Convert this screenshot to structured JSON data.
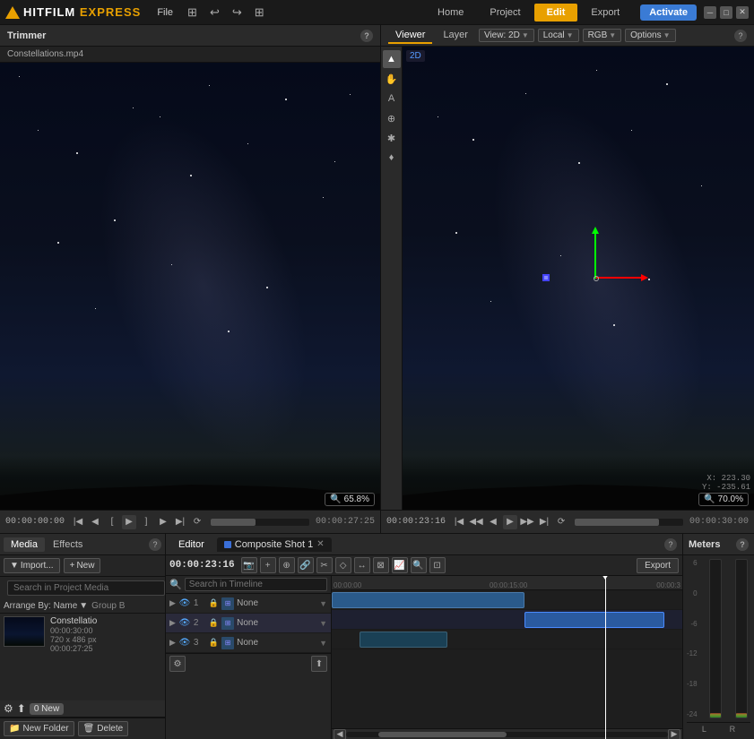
{
  "app": {
    "name": "HITFILM",
    "name_accent": "EXPRESS",
    "logo_text": "HitFilm Express"
  },
  "menubar": {
    "file": "File",
    "edit_menu": "Edit",
    "project": "Project",
    "icons": [
      "⧉",
      "↩",
      "↪",
      "⊞"
    ],
    "nav": {
      "home": "Home",
      "project_tab": "Project",
      "edit_tab": "Edit",
      "export_tab": "Export",
      "activate": "Activate"
    },
    "win_controls": [
      "─",
      "□",
      "✕"
    ]
  },
  "trimmer": {
    "title": "Trimmer",
    "filename": "Constellations.mp4",
    "zoom_label": "65.8%",
    "time_start": "00:00:00:00",
    "time_end": "00:00:27:25",
    "help": "?"
  },
  "viewer": {
    "title": "Viewer",
    "tabs": [
      "Viewer",
      "Layer"
    ],
    "view_label": "View: 2D",
    "local_label": "Local",
    "rgb_label": "RGB",
    "options_label": "Options",
    "badge_2d": "2D",
    "coords_x": "X: 223.30",
    "coords_y": "Y: -235.61",
    "zoom_label": "70.0%",
    "time": "00:00:23:16",
    "time_end": "00:00:30:00"
  },
  "tools": {
    "items": [
      "▲",
      "✋",
      "A",
      "⊕",
      "✱",
      "♦"
    ]
  },
  "media_panel": {
    "title": "Media",
    "tabs": [
      "Media",
      "Effects"
    ],
    "import_label": "Import...",
    "new_label": "New",
    "search_placeholder": "Search in Project Media",
    "arrange_label": "Arrange By: Name",
    "group_label": "Group B",
    "media_item": {
      "name": "Constellatio",
      "full_name": "Constellations.mp4",
      "duration": "00:00:30:00",
      "resolution": "720 x 486 px",
      "timecode": "00:00:27:25"
    },
    "new_folder": "New Folder",
    "delete": "Delete",
    "new_notification": "0 New"
  },
  "editor": {
    "title": "Editor",
    "comp_shot_label": "Composite Shot 1",
    "time": "00:00:23:16",
    "export_label": "Export",
    "search_placeholder": "Search in Timeline",
    "tracks": [
      {
        "num": "1",
        "name": "None"
      },
      {
        "num": "2",
        "name": "None"
      },
      {
        "num": "3",
        "name": "None"
      }
    ],
    "ruler_marks": [
      "00:00:00",
      "00:00:15:00",
      "00:00:3"
    ]
  },
  "meters": {
    "title": "Meters",
    "db_labels": [
      "6",
      "0",
      "-6",
      "-12",
      "-18",
      "-24"
    ],
    "channels": [
      "L",
      "R"
    ],
    "help": "?"
  }
}
